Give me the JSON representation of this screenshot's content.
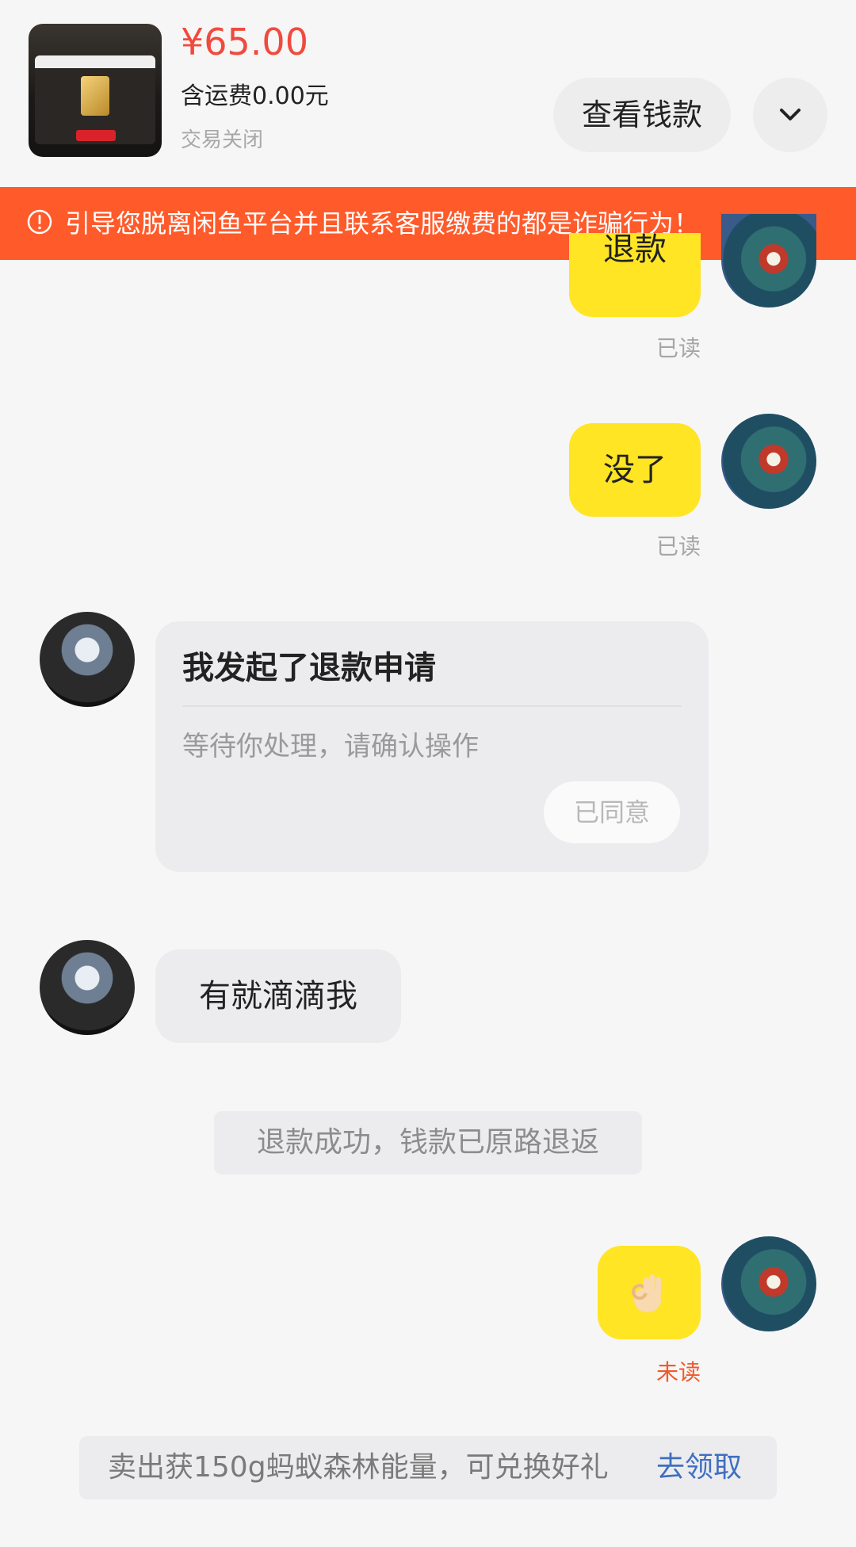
{
  "header": {
    "price": "¥65.00",
    "shipping": "含运费0.00元",
    "status": "交易关闭",
    "view_money_label": "查看钱款",
    "expand_icon": "chevron-down-icon"
  },
  "warning": {
    "text": "引导您脱离闲鱼平台并且联系客服缴费的都是诈骗行为！",
    "icon": "exclamation-circle-icon",
    "color": "#ff5a2a"
  },
  "messages": [
    {
      "side": "mine",
      "text": "退款",
      "read_status": "已读"
    },
    {
      "side": "mine",
      "text": "没了",
      "read_status": "已读"
    },
    {
      "side": "theirs",
      "type": "refund_card",
      "title": "我发起了退款申请",
      "subtitle": "等待你处理，请确认操作",
      "action_label": "已同意"
    },
    {
      "side": "theirs",
      "text": "有就滴滴我"
    },
    {
      "type": "system",
      "text": "退款成功，钱款已原路退返"
    },
    {
      "side": "mine",
      "text": "👌",
      "icon": "ok-hand-emoji",
      "read_status": "未读"
    }
  ],
  "promo": {
    "text": "卖出获150g蚂蚁森林能量，可兑换好礼",
    "link": "去领取"
  },
  "colors": {
    "price": "#f04a3d",
    "my_bubble": "#ffe524",
    "their_bubble": "#ececef",
    "unread": "#f05a2a",
    "link": "#3f6fbf"
  }
}
